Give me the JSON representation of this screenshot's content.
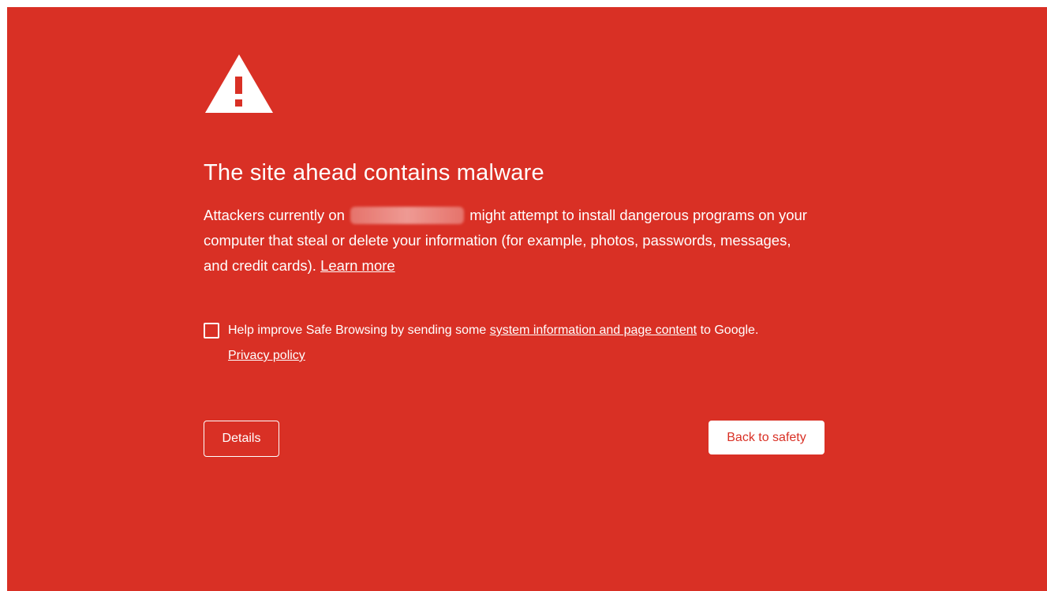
{
  "icon": "warning-triangle-icon",
  "colors": {
    "background": "#d93025",
    "text": "#ffffff",
    "primary_button_bg": "#ffffff",
    "primary_button_text": "#d93025"
  },
  "main": {
    "title": "The site ahead contains malware",
    "description": {
      "before": "Attackers currently on",
      "after": "might attempt to install dangerous programs on your computer that steal or delete your information (for example, photos, passwords, messages, and credit cards).",
      "learn_more": "Learn more"
    }
  },
  "optin": {
    "text_before": "Help improve Safe Browsing by sending some",
    "link": "system information and page content",
    "text_after": "to Google.",
    "privacy_link": "Privacy policy"
  },
  "buttons": {
    "details": "Details",
    "back_to_safety": "Back to safety"
  }
}
